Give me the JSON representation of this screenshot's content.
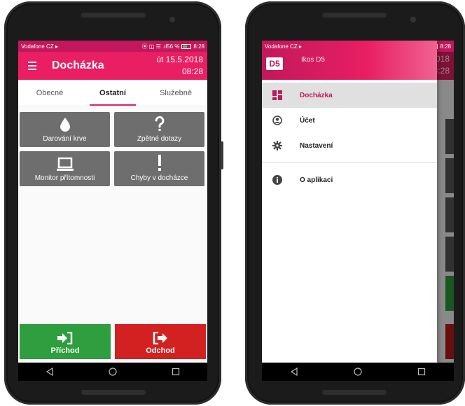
{
  "colors": {
    "primary": "#e91e63",
    "primary_dark": "#c2185b",
    "tile": "#6e6e6e",
    "green": "#2e9e3e",
    "red": "#d32020"
  },
  "status_bar": {
    "carrier": "Vodafone CZ ▸",
    "right": "⦿ ◫ ☰ .ıl56 %",
    "time": "8:28"
  },
  "toolbar": {
    "title": "Docházka",
    "date": "út 15.5.2018",
    "time": "08:28"
  },
  "tabs": [
    {
      "label": "Obecné"
    },
    {
      "label": "Ostatní"
    },
    {
      "label": "Služebně"
    }
  ],
  "tiles": [
    {
      "label": "Darování krve",
      "icon": "drop-icon"
    },
    {
      "label": "Zpětné dotazy",
      "icon": "question-icon"
    },
    {
      "label": "Monitor přítomnosti",
      "icon": "laptop-icon"
    },
    {
      "label": "Chyby v docházce",
      "icon": "exclamation-icon"
    }
  ],
  "buttons": {
    "arrival": "Příchod",
    "departure": "Odchod"
  },
  "drawer": {
    "logo": "D5",
    "user": "Ikos D5",
    "items": [
      {
        "label": "Docházka",
        "icon": "dashboard-icon"
      },
      {
        "label": "Účet",
        "icon": "account-icon"
      },
      {
        "label": "Nastavení",
        "icon": "gear-icon"
      },
      {
        "label": "O aplikaci",
        "icon": "info-icon"
      }
    ]
  },
  "underlay": {
    "date": "018",
    "time": "8:28"
  }
}
